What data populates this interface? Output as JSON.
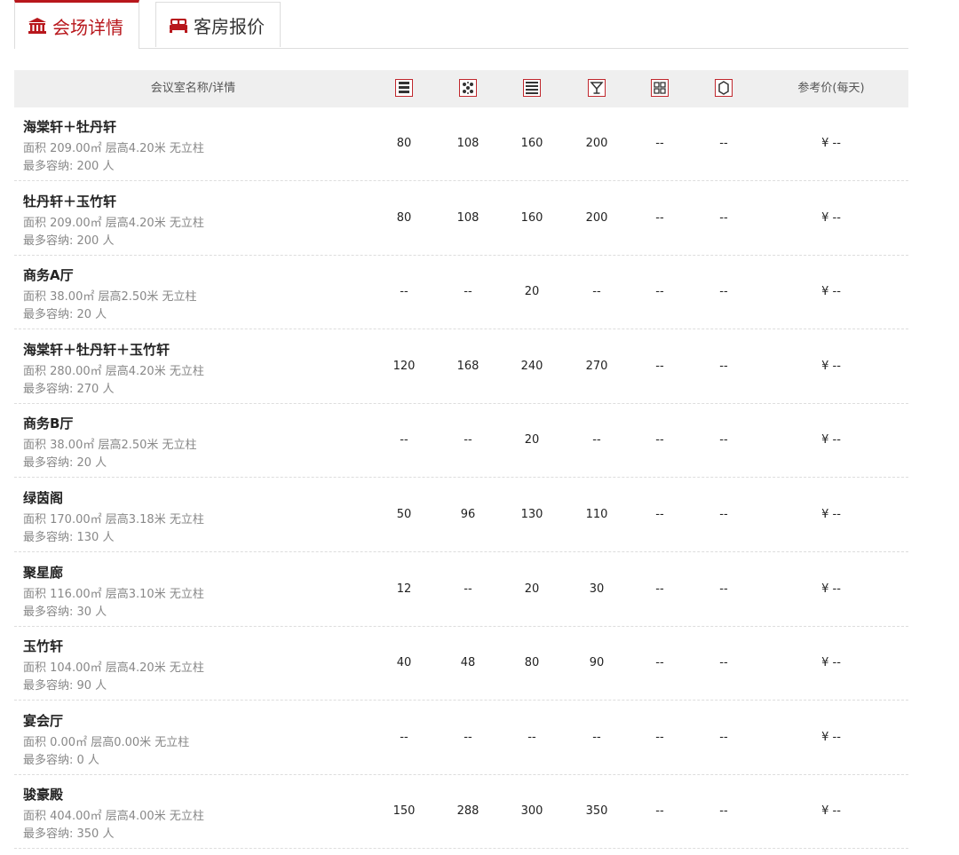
{
  "tabs": [
    {
      "label": "会场详情",
      "icon": "building-icon",
      "active": true
    },
    {
      "label": "客房报价",
      "icon": "bed-icon",
      "active": false
    }
  ],
  "accent_color": "#b8171c",
  "header": {
    "name": "会议室名称/详情",
    "layout_icons": [
      "theatre-layout-icon",
      "banquet-layout-icon",
      "classroom-layout-icon",
      "cocktail-layout-icon",
      "board-layout-icon",
      "u-shape-layout-icon"
    ],
    "price": "参考价(每天)"
  },
  "rows": [
    {
      "name": "海棠轩＋牡丹轩",
      "details": "面积 209.00㎡ 层高4.20米 无立柱",
      "capacity": "最多容纳: 200 人",
      "values": [
        "80",
        "108",
        "160",
        "200",
        "--",
        "--"
      ],
      "price": "¥ --"
    },
    {
      "name": "牡丹轩＋玉竹轩",
      "details": "面积 209.00㎡ 层高4.20米 无立柱",
      "capacity": "最多容纳: 200 人",
      "values": [
        "80",
        "108",
        "160",
        "200",
        "--",
        "--"
      ],
      "price": "¥ --"
    },
    {
      "name": "商务A厅",
      "details": "面积 38.00㎡ 层高2.50米 无立柱",
      "capacity": "最多容纳: 20 人",
      "values": [
        "--",
        "--",
        "20",
        "--",
        "--",
        "--"
      ],
      "price": "¥ --"
    },
    {
      "name": "海棠轩＋牡丹轩＋玉竹轩",
      "details": "面积 280.00㎡ 层高4.20米 无立柱",
      "capacity": "最多容纳: 270 人",
      "values": [
        "120",
        "168",
        "240",
        "270",
        "--",
        "--"
      ],
      "price": "¥ --"
    },
    {
      "name": "商务B厅",
      "details": "面积 38.00㎡ 层高2.50米 无立柱",
      "capacity": "最多容纳: 20 人",
      "values": [
        "--",
        "--",
        "20",
        "--",
        "--",
        "--"
      ],
      "price": "¥ --"
    },
    {
      "name": "绿茵阁",
      "details": "面积 170.00㎡ 层高3.18米 无立柱",
      "capacity": "最多容纳: 130 人",
      "values": [
        "50",
        "96",
        "130",
        "110",
        "--",
        "--"
      ],
      "price": "¥ --"
    },
    {
      "name": "聚星廊",
      "details": "面积 116.00㎡ 层高3.10米 无立柱",
      "capacity": "最多容纳: 30 人",
      "values": [
        "12",
        "--",
        "20",
        "30",
        "--",
        "--"
      ],
      "price": "¥ --"
    },
    {
      "name": "玉竹轩",
      "details": "面积 104.00㎡ 层高4.20米 无立柱",
      "capacity": "最多容纳: 90 人",
      "values": [
        "40",
        "48",
        "80",
        "90",
        "--",
        "--"
      ],
      "price": "¥ --"
    },
    {
      "name": "宴会厅",
      "details": "面积 0.00㎡ 层高0.00米 无立柱",
      "capacity": "最多容纳: 0 人",
      "values": [
        "--",
        "--",
        "--",
        "--",
        "--",
        "--"
      ],
      "price": "¥ --"
    },
    {
      "name": "骏豪殿",
      "details": "面积 404.00㎡ 层高4.00米 无立柱",
      "capacity": "最多容纳: 350 人",
      "values": [
        "150",
        "288",
        "300",
        "350",
        "--",
        "--"
      ],
      "price": "¥ --"
    }
  ]
}
